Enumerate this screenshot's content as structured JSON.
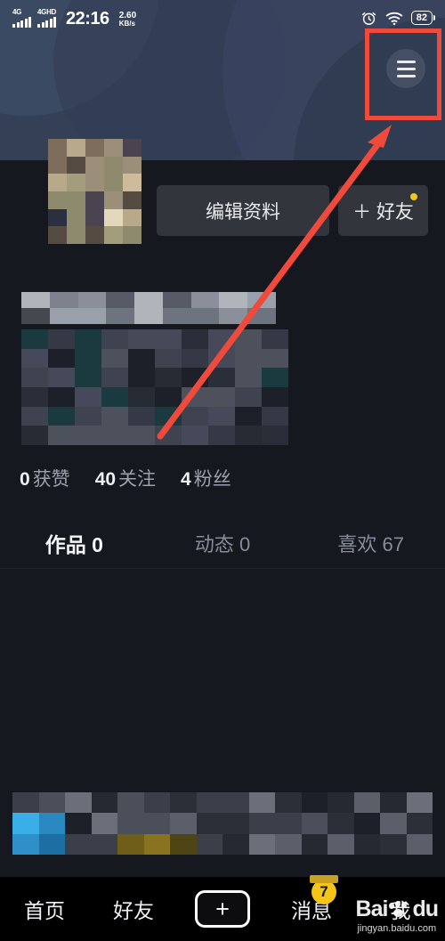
{
  "status_bar": {
    "signal_1_label": "4G",
    "signal_2_label": "4GHD",
    "time": "22:16",
    "net_speed_value": "2.60",
    "net_speed_unit": "KB/s",
    "alarm_icon": "alarm-clock-icon",
    "wifi_icon": "wifi-icon",
    "battery_percent": "82"
  },
  "header": {
    "menu_icon": "hamburger-menu-icon",
    "annotation_box_color": "#f04a3c",
    "annotation_arrow_color": "#f04a3c"
  },
  "profile": {
    "avatar_label": "avatar-pixelated",
    "username_label": "username-pixelated",
    "bio_label": "bio-pixelated",
    "edit_button": "编辑资料",
    "add_friend_button": "＋ 好友",
    "add_friend_badge_color": "#f5c518"
  },
  "stats": [
    {
      "count": "0",
      "label": "获赞"
    },
    {
      "count": "40",
      "label": "关注"
    },
    {
      "count": "4",
      "label": "粉丝"
    }
  ],
  "tabs": [
    {
      "label": "作品 0",
      "active": true
    },
    {
      "label": "动态 0",
      "active": false
    },
    {
      "label": "喜欢 67",
      "active": false
    }
  ],
  "tab_underline_color": "#e3b22a",
  "bottom_nav": {
    "home": "首页",
    "friends": "好友",
    "create_icon": "plus-icon",
    "messages": "消息",
    "messages_badge": "7",
    "me": "我"
  },
  "watermark": {
    "brand": "Bai",
    "brand_suffix": "du",
    "paw_icon": "baidu-paw-icon",
    "overlay_text": "我",
    "url": "jingyan.baidu.com"
  },
  "colors": {
    "banner": "#344055",
    "page_bg": "#15181f",
    "button_bg": "#32353c",
    "accent_yellow": "#e3b22a",
    "nav_bg": "#000000",
    "plus_cyan": "#22dfe8",
    "plus_pink": "#fe2c55"
  }
}
